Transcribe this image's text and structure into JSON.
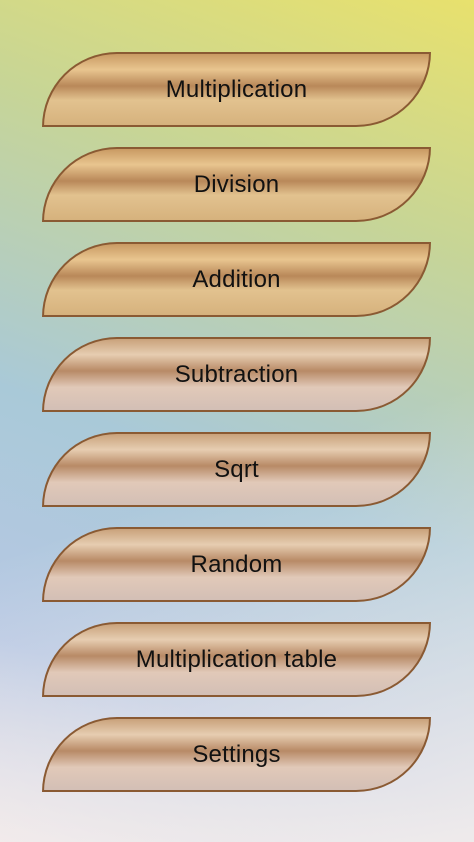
{
  "menu": {
    "items": [
      {
        "label": "Multiplication"
      },
      {
        "label": "Division"
      },
      {
        "label": "Addition"
      },
      {
        "label": "Subtraction"
      },
      {
        "label": "Sqrt"
      },
      {
        "label": "Random"
      },
      {
        "label": "Multiplication table"
      },
      {
        "label": "Settings"
      }
    ]
  },
  "colors": {
    "button_border": "#8a5a33",
    "background_top": "#e8e16d",
    "background_bottom": "#efe7ea"
  }
}
